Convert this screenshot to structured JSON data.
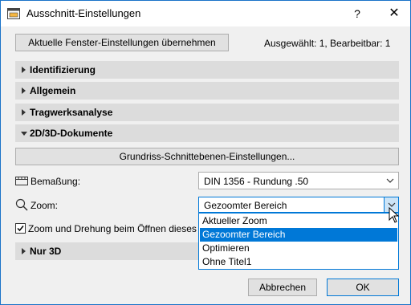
{
  "window": {
    "title": "Ausschnitt-Einstellungen",
    "help_label": "?",
    "close_label": "✕"
  },
  "toolbar": {
    "apply_label": "Aktuelle Fenster-Einstellungen übernehmen",
    "status": "Ausgewählt: 1, Bearbeitbar: 1"
  },
  "sections": [
    {
      "label": "Identifizierung",
      "expanded": false
    },
    {
      "label": "Allgemein",
      "expanded": false
    },
    {
      "label": "Tragwerksanalyse",
      "expanded": false
    },
    {
      "label": "2D/3D-Dokumente",
      "expanded": true
    },
    {
      "label": "Nur 3D",
      "expanded": false
    }
  ],
  "docs": {
    "floorplan_button": "Grundriss-Schnittebenen-Einstellungen...",
    "dimension_label": "Bemaßung:",
    "dimension_value": "DIN 1356 - Rundung .50",
    "zoom_label": "Zoom:",
    "zoom_value": "Gezoomter Bereich",
    "zoom_options": [
      "Aktueller Zoom",
      "Gezoomter Bereich",
      "Optimieren",
      "Ohne Titel1"
    ],
    "zoom_selected_index": 1,
    "checkbox_label": "Zoom und Drehung beim Öffnen dieses A",
    "checkbox_checked": true
  },
  "footer": {
    "cancel_label": "Abbrechen",
    "ok_label": "OK"
  },
  "colors": {
    "accent": "#0078d7",
    "section_bg": "#dcdcdc",
    "dialog_bg": "#f0f0f0"
  }
}
